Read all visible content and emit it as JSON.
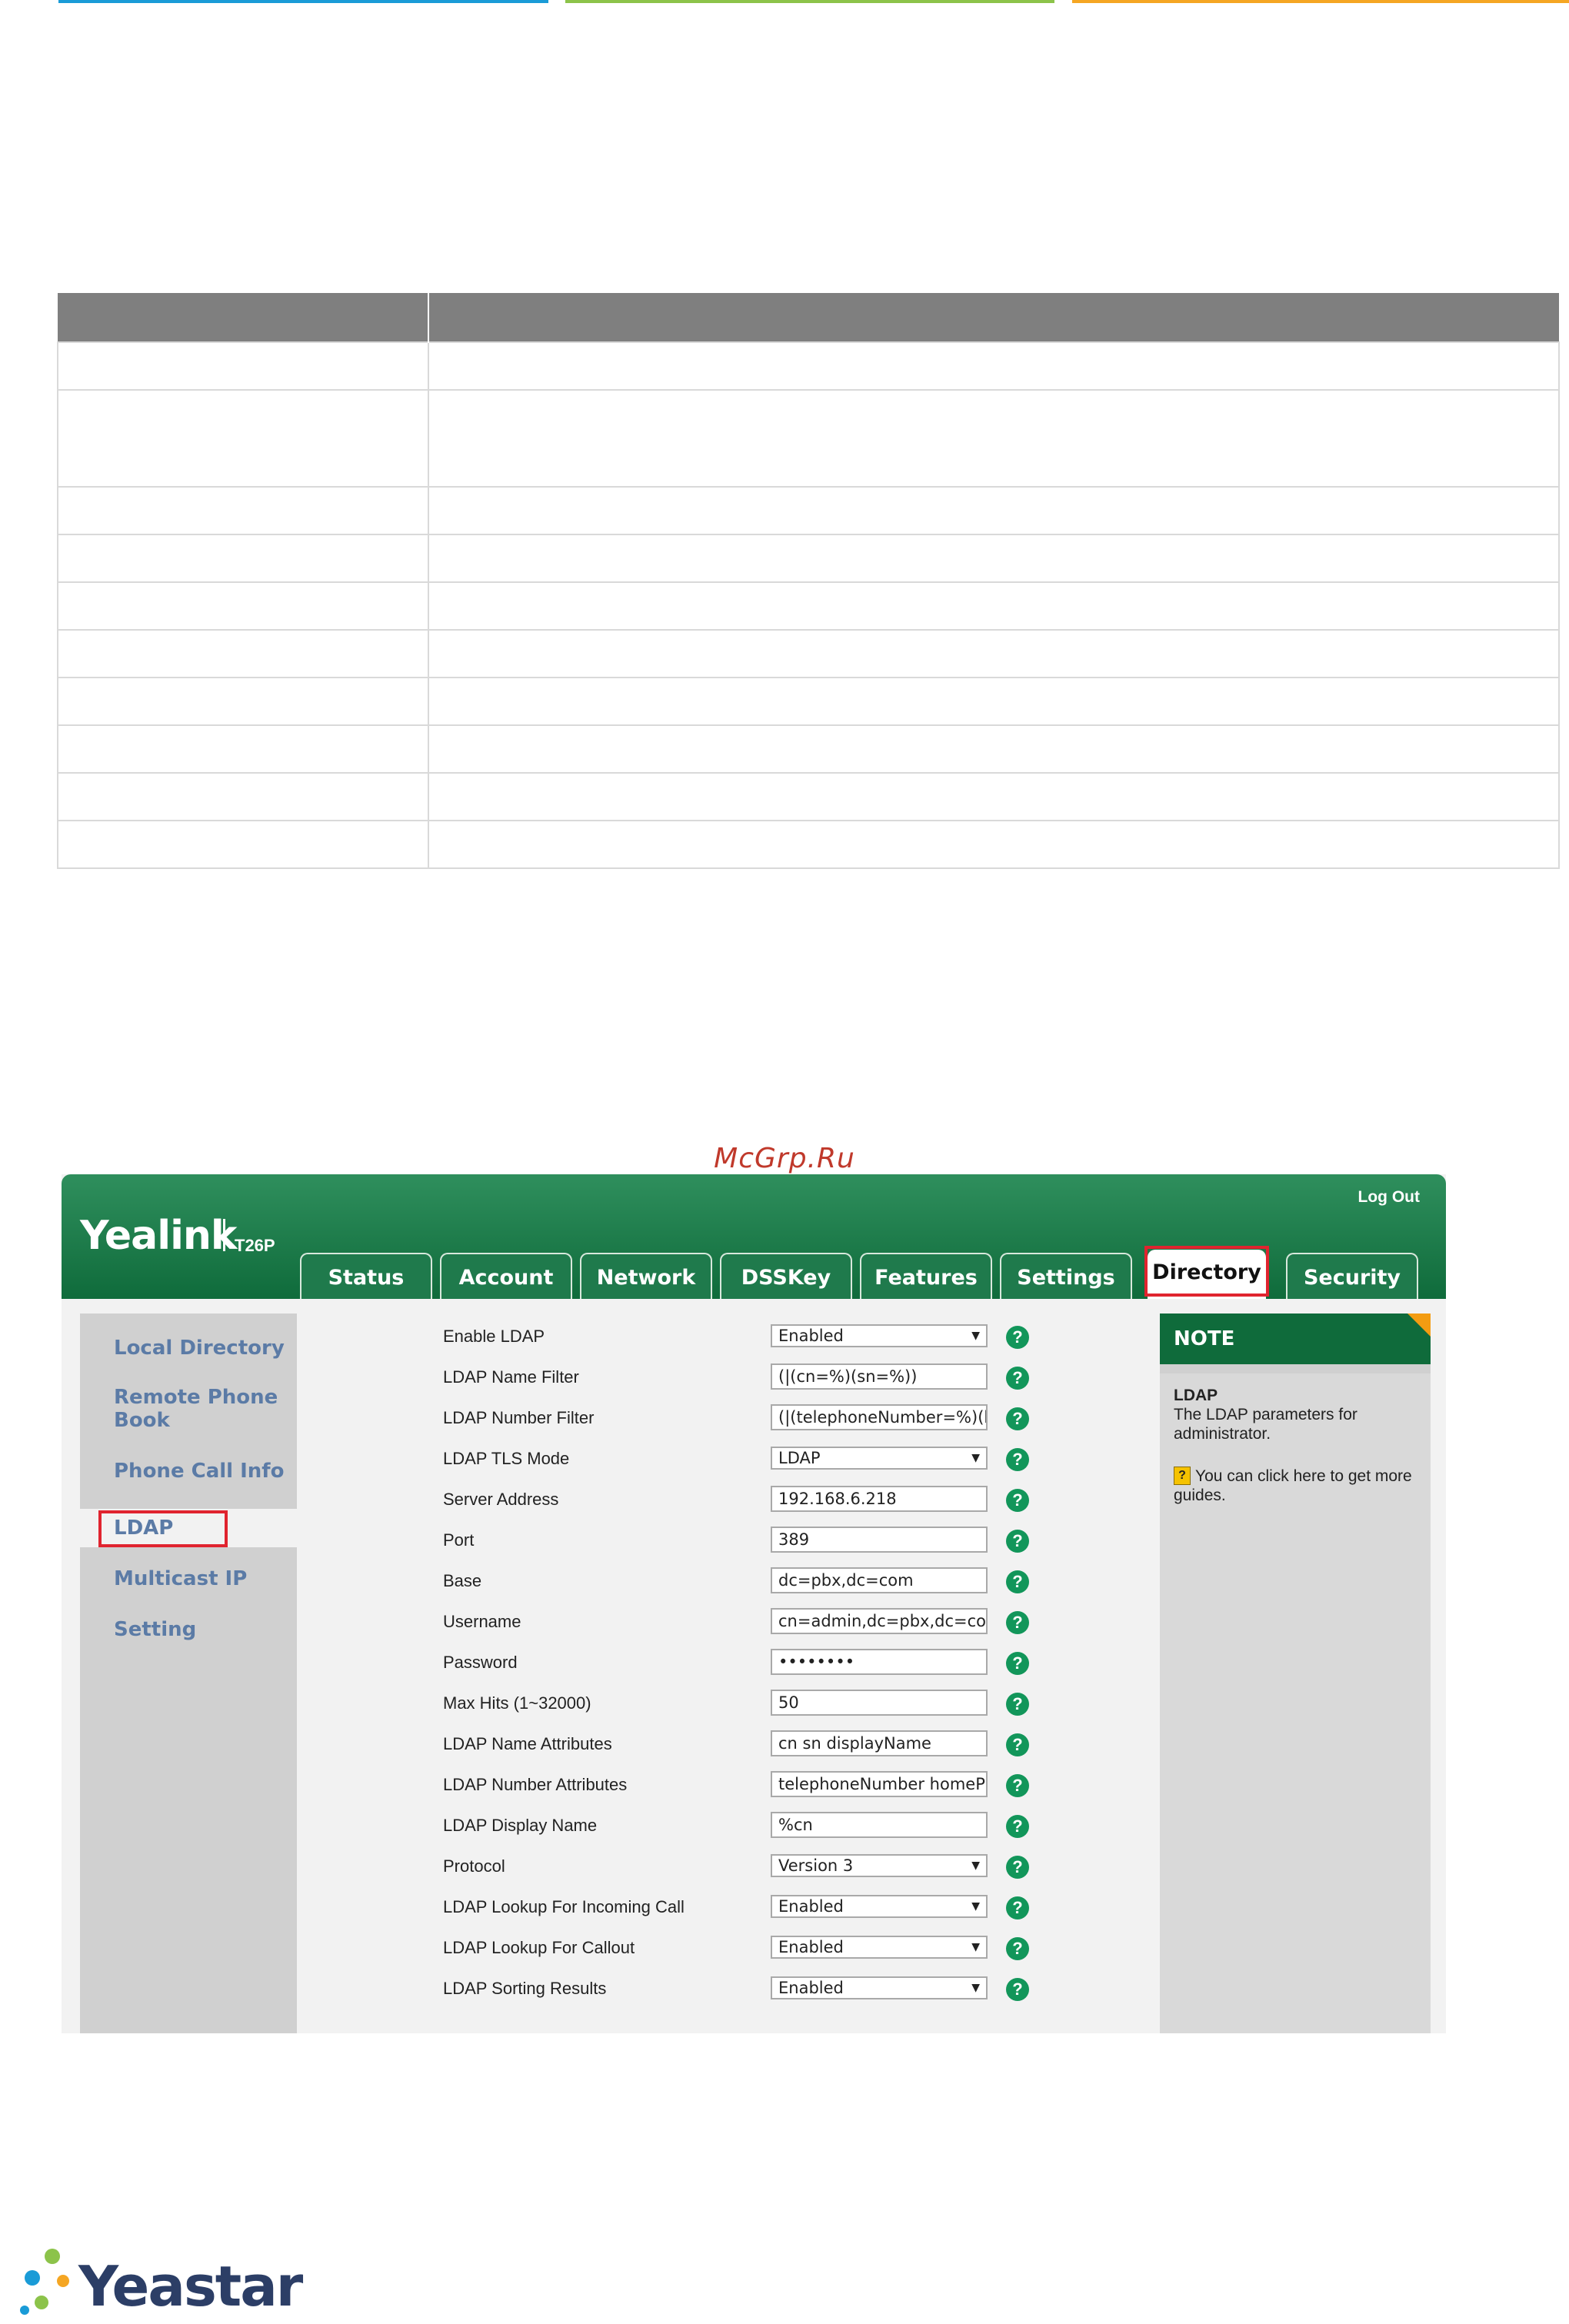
{
  "watermark": "McGrp.Ru",
  "ui": {
    "brand": "Yealink",
    "model": "T26P",
    "logout": "Log Out",
    "tabs": [
      {
        "label": "Status"
      },
      {
        "label": "Account"
      },
      {
        "label": "Network"
      },
      {
        "label": "DSSKey"
      },
      {
        "label": "Features"
      },
      {
        "label": "Settings"
      },
      {
        "label": "Directory",
        "active": true
      },
      {
        "label": "Security"
      }
    ],
    "sidebar": [
      {
        "label": "Local Directory"
      },
      {
        "label": "Remote Phone Book"
      },
      {
        "label": "Phone Call Info"
      },
      {
        "label": "LDAP",
        "active": true
      },
      {
        "label": "Multicast IP"
      },
      {
        "label": "Setting"
      }
    ],
    "fields": [
      {
        "label": "Enable LDAP",
        "type": "select",
        "value": "Enabled"
      },
      {
        "label": "LDAP Name Filter",
        "type": "input",
        "value": "(|(cn=%)(sn=%))"
      },
      {
        "label": "LDAP Number Filter",
        "type": "input",
        "value": "(|(telephoneNumber=%)(hc"
      },
      {
        "label": "LDAP TLS Mode",
        "type": "select",
        "value": "LDAP"
      },
      {
        "label": "Server Address",
        "type": "input",
        "value": "192.168.6.218"
      },
      {
        "label": "Port",
        "type": "input",
        "value": "389"
      },
      {
        "label": "Base",
        "type": "input",
        "value": "dc=pbx,dc=com"
      },
      {
        "label": "Username",
        "type": "input",
        "value": "cn=admin,dc=pbx,dc=com"
      },
      {
        "label": "Password",
        "type": "input",
        "value": "••••••••"
      },
      {
        "label": "Max Hits (1~32000)",
        "type": "input",
        "value": "50"
      },
      {
        "label": "LDAP Name Attributes",
        "type": "input",
        "value": "cn sn displayName"
      },
      {
        "label": "LDAP Number Attributes",
        "type": "input",
        "value": "telephoneNumber homePhor"
      },
      {
        "label": "LDAP Display Name",
        "type": "input",
        "value": "%cn"
      },
      {
        "label": "Protocol",
        "type": "select",
        "value": "Version 3"
      },
      {
        "label": "LDAP Lookup For Incoming Call",
        "type": "select",
        "value": "Enabled"
      },
      {
        "label": "LDAP Lookup For Callout",
        "type": "select",
        "value": "Enabled"
      },
      {
        "label": "LDAP Sorting Results",
        "type": "select",
        "value": "Enabled"
      }
    ],
    "note": {
      "header": "NOTE",
      "title": "LDAP",
      "description": "The LDAP parameters for administrator.",
      "guide_icon": "?",
      "guide": "You can click here to get more guides."
    }
  },
  "footer": {
    "brand": "Yeastar"
  }
}
